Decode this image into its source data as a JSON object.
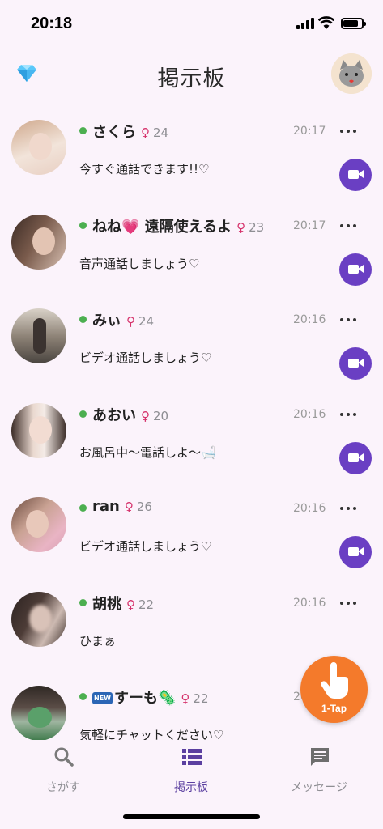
{
  "status_bar": {
    "time": "20:18"
  },
  "header": {
    "title": "掲示板",
    "left_icon": "diamond-gem-icon",
    "right_avatar": "cat-avatar"
  },
  "posts": [
    {
      "name": "さくら",
      "gender": "♀",
      "age": "24",
      "time": "20:17",
      "message": "今すぐ通話できます!!♡",
      "video": true
    },
    {
      "name": "ねね💗 遠隔使えるよ",
      "gender": "♀",
      "age": "23",
      "time": "20:17",
      "message": "音声通話しましょう♡",
      "video": true
    },
    {
      "name": "みぃ",
      "gender": "♀",
      "age": "24",
      "time": "20:16",
      "message": "ビデオ通話しましょう♡",
      "video": true
    },
    {
      "name": "あおい",
      "gender": "♀",
      "age": "20",
      "time": "20:16",
      "message": "お風呂中〜電話しよ〜🛁",
      "video": true
    },
    {
      "name": "ran",
      "gender": "♀",
      "age": "26",
      "time": "20:16",
      "message": "ビデオ通話しましょう♡",
      "video": true
    },
    {
      "name": "胡桃",
      "gender": "♀",
      "age": "22",
      "time": "20:16",
      "message": "ひまぁ",
      "video": false
    },
    {
      "badge": "NEW",
      "name": "すーも🦠",
      "gender": "♀",
      "age": "22",
      "time": "20:16",
      "message": "気軽にチャットください♡",
      "video": false
    }
  ],
  "tap_button": {
    "label": "1-Tap"
  },
  "tabs": [
    {
      "label": "さがす",
      "icon": "search-icon"
    },
    {
      "label": "掲示板",
      "icon": "list-icon",
      "active": true
    },
    {
      "label": "メッセージ",
      "icon": "chat-icon"
    }
  ],
  "colors": {
    "accent": "#6a3fc3",
    "online": "#4caf50",
    "gender": "#d6336c",
    "tap": "#f47a2b",
    "background": "#fbf3fb"
  }
}
